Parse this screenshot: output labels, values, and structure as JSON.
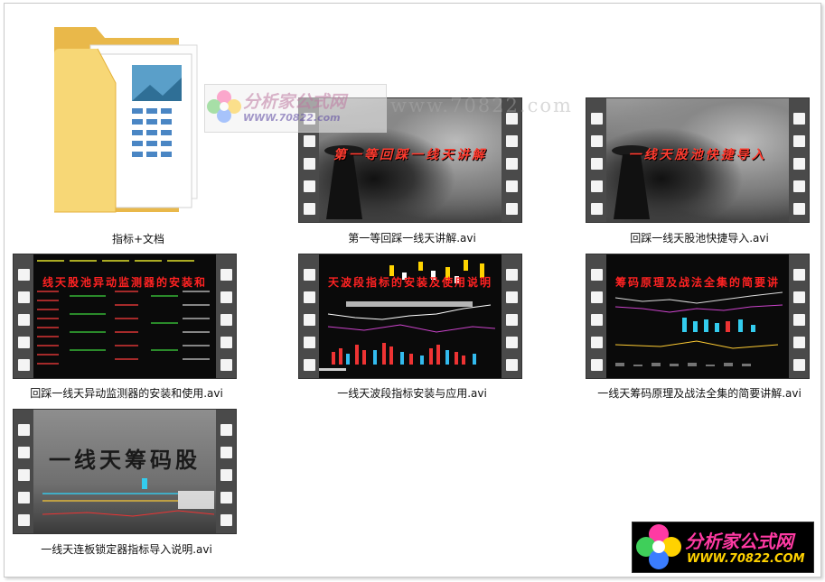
{
  "files": [
    {
      "name": "指标+文档",
      "type": "folder"
    },
    {
      "name": "第一等回踩一线天讲解.avi",
      "type": "video",
      "overlay_text": "第一等回踩一线天讲解"
    },
    {
      "name": "回踩一线天股池快捷导入.avi",
      "type": "video",
      "overlay_text": "一线天股池快捷导入"
    },
    {
      "name": "回踩一线天异动监测器的安装和使用.avi",
      "type": "video",
      "overlay_text": "线天股池异动监测器的安装和"
    },
    {
      "name": "一线天波段指标安装与应用.avi",
      "type": "video",
      "overlay_text": "天波段指标的安装及使用说明"
    },
    {
      "name": "一线天筹码原理及战法全集的简要讲解.avi",
      "type": "video",
      "overlay_text": "筹码原理及战法全集的简要讲"
    },
    {
      "name": "一线天连板锁定器指标导入说明.avi",
      "type": "video",
      "overlay_text": "一线天筹码股"
    }
  ],
  "watermarks": {
    "top_title": "分析家公式网",
    "top_url": "WWW.70822.com",
    "ghost_url": "www.70822.com",
    "badge_title": "分析家公式网",
    "badge_url": "WWW.70822.COM"
  },
  "colors": {
    "banner_red": "#ff3b2f",
    "folder_yellow": "#f5cd62",
    "badge_pink": "#ff3aa3",
    "badge_yellow": "#ffd200"
  }
}
